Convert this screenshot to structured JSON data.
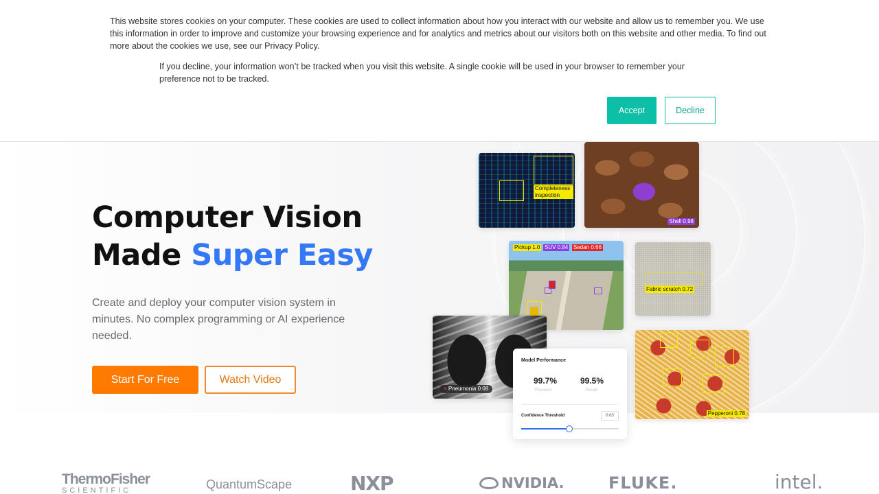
{
  "cookie_banner": {
    "text_primary": "This website stores cookies on your computer. These cookies are used to collect information about how you interact with our website and allow us to remember you. We use this information in order to improve and customize your browsing experience and for analytics and metrics about our visitors both on this website and other media. To find out more about the cookies we use, see our Privacy Policy.",
    "text_secondary": "If you decline, your information won’t be tracked when you visit this website. A single cookie will be used in your browser to remember your preference not to be tracked.",
    "accept_label": "Accept",
    "decline_label": "Decline"
  },
  "hero": {
    "headline_line1": "Computer Vision",
    "headline_line2_prefix": "Made ",
    "headline_line2_accent": "Super Easy",
    "subtext": "Create and deploy your computer vision system in minutes. No complex programming or AI experience needed.",
    "primary_cta": "Start For Free",
    "secondary_cta": "Watch Video"
  },
  "showcase": {
    "pcb_label": "Completeness inspection",
    "almond_label": "Shell 0.98",
    "vehicle_labels": [
      "Pickup 1.0",
      "SUV 0.84",
      "Sedan 0.66"
    ],
    "fabric_label": "Fabric scratch 0.72",
    "xray_label": "Pneumonia 0.08",
    "pizza_label": "Pepperoni 0.78"
  },
  "model_performance": {
    "title": "Model Performance",
    "precision_value": "99.7%",
    "precision_label": "Precision",
    "recall_value": "99.5%",
    "recall_label": "Recall",
    "threshold_label": "Confidence Threshold",
    "threshold_value": "0.63",
    "threshold_fraction": 0.49
  },
  "logos": {
    "thermofisher_main": "ThermoFisher",
    "thermofisher_sub": "SCIENTIFIC",
    "quantumscape": "QuantumScape",
    "nxp": "NXP",
    "nvidia": "NVIDIA.",
    "fluke": "FLUKE.",
    "intel": "intel."
  },
  "colors": {
    "accent_blue": "#3478f6",
    "cta_orange": "#ff7a00",
    "cookie_teal": "#0dbfa6"
  }
}
